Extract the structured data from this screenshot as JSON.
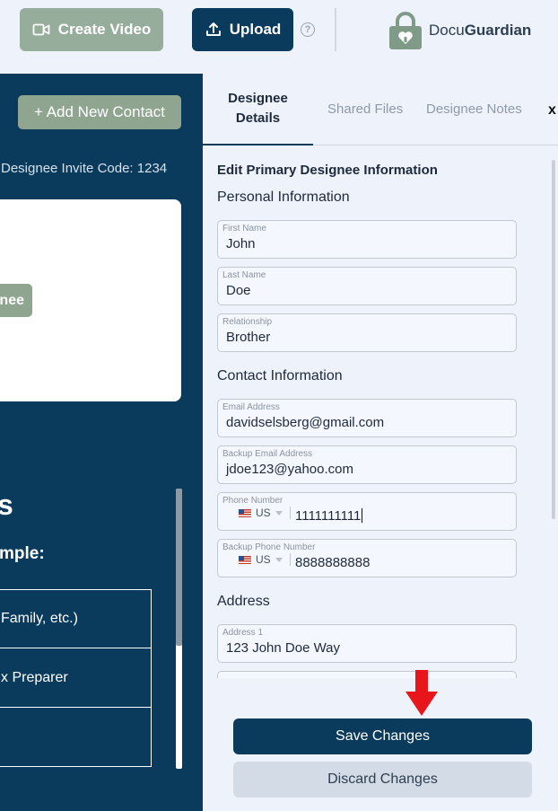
{
  "topbar": {
    "create_video_label": "Create Video",
    "upload_label": "Upload",
    "help_glyph": "?",
    "logo_part1": "Docu",
    "logo_part2": "Guardian"
  },
  "left": {
    "add_contact_label": "+ Add New Contact",
    "invite_code": "Designee Invite Code: 1234",
    "card_button_fragment": "nee",
    "heading_fragment": "s",
    "example_fragment": "mple:",
    "rows": [
      "Family, etc.)",
      "x Preparer",
      ""
    ]
  },
  "tabs": {
    "designee_details": "Designee Details",
    "shared_files": "Shared Files",
    "designee_notes": "Designee Notes",
    "close": "x"
  },
  "form": {
    "title": "Edit Primary Designee Information",
    "personal_section": "Personal Information",
    "first_name_label": "First Name",
    "first_name_value": "John",
    "last_name_label": "Last Name",
    "last_name_value": "Doe",
    "relationship_label": "Relationship",
    "relationship_value": "Brother",
    "contact_section": "Contact Information",
    "email_label": "Email Address",
    "email_value": "davidselsberg@gmail.com",
    "backup_email_label": "Backup Email Address",
    "backup_email_value": "jdoe123@yahoo.com",
    "phone_label": "Phone Number",
    "phone_country": "US",
    "phone_value": "1111111111",
    "backup_phone_label": "Backup Phone Number",
    "backup_phone_country": "US",
    "backup_phone_value": "8888888888",
    "address_section": "Address",
    "address1_label": "Address 1",
    "address1_value": "123 John Doe Way"
  },
  "actions": {
    "save_label": "Save Changes",
    "discard_label": "Discard Changes"
  },
  "colors": {
    "navy": "#0b3b5c",
    "sage": "#8fa590",
    "arrow_red": "#e8151b"
  }
}
